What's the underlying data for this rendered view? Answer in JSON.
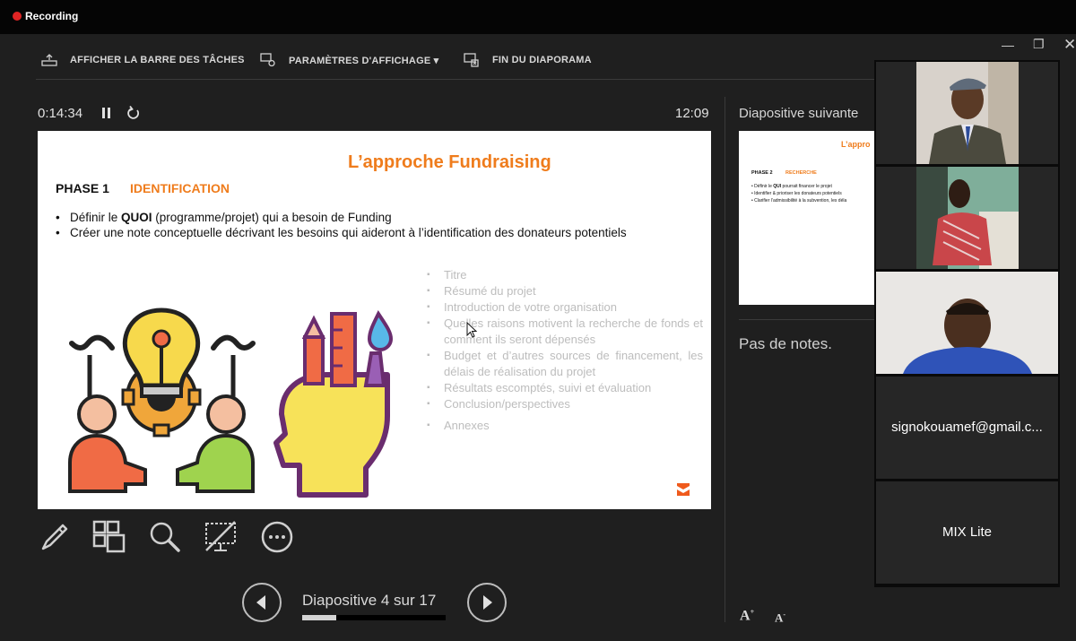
{
  "recording": {
    "label": "Recording"
  },
  "toolbar": {
    "show_taskbar": "AFFICHER LA BARRE DES TÂCHES",
    "display_settings": "PARAMÈTRES D'AFFICHAGE ▾",
    "end_slideshow": "FIN DU DIAPORAMA"
  },
  "presenter": {
    "elapsed": "0:14:34",
    "clock": "12:09"
  },
  "slide": {
    "title": "L’approche Fundraising",
    "phase_label": "PHASE 1",
    "phase_name": "IDENTIFICATION",
    "bullet1_pre": "Définir le ",
    "bullet1_bold": "QUOI",
    "bullet1_post": " (programme/projet) qui a besoin de Funding",
    "bullet2": "Créer une note conceptuelle décrivant les besoins qui aideront à l’identification des donateurs potentiels",
    "list": [
      "Titre",
      "Résumé du projet",
      "Introduction de votre organisation",
      "Quelles raisons motivent la recherche de fonds et comment ils seront dépensés",
      "Budget et  d’autres sources de financement, les délais de réalisation du projet",
      "Résultats escomptés, suivi et évaluation",
      "Conclusion/perspectives",
      "Annexes"
    ]
  },
  "navigation": {
    "counter": "Diapositive 4 sur 17",
    "current": 4,
    "total": 17
  },
  "next_slide": {
    "label": "Diapositive suivante",
    "title": "L’appro",
    "phase_label": "PHASE 2",
    "phase_name": "RECHERCHE",
    "b1_pre": "Définir le ",
    "b1_bold": "QUI",
    "b1_post": " pourrait financer le projet",
    "b2": "Identifier  & prioriser les donateurs potentiels",
    "b3": "Clarifier l’admissibilité à la subvention, les déla"
  },
  "notes": {
    "text": "Pas de notes."
  },
  "participants": [
    {
      "name": "",
      "has_video": true
    },
    {
      "name": "",
      "has_video": true
    },
    {
      "name": "",
      "has_video": true
    },
    {
      "name": "signokouamef@gmail.c...",
      "has_video": false
    },
    {
      "name": "MIX Lite",
      "has_video": false
    }
  ],
  "colors": {
    "accent": "#ef7c1c",
    "background": "#1f1f1f",
    "recording": "#e02424"
  }
}
